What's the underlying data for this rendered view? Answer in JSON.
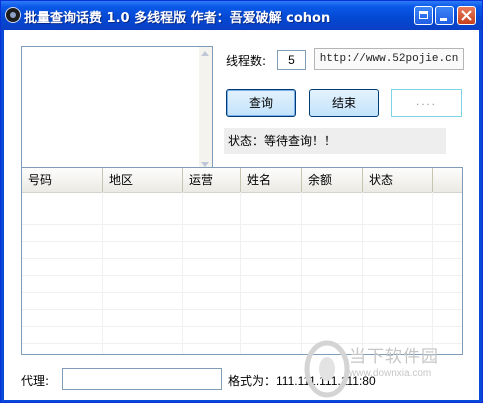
{
  "window": {
    "title": "批量查询话费 1.0 多线程版 作者：吾爱破解 cohon"
  },
  "controls": {
    "threads_label": "线程数:",
    "threads_value": "5",
    "url": "http://www.52pojie.cn",
    "query_button": "查询",
    "stop_button": "结束",
    "dots_box": "....",
    "status_text": "状态：等待查询！！"
  },
  "table": {
    "columns": [
      "号码",
      "地区",
      "运营",
      "姓名",
      "余额",
      "状态"
    ],
    "rows": []
  },
  "footer": {
    "proxy_label": "代理:",
    "proxy_value": "",
    "format_label": "格式为：111.111.111.111:80"
  },
  "watermark": {
    "text": "当下软件园",
    "url": "www.downxia.com"
  },
  "colors": {
    "titlebar": "#0a58e8",
    "button_face": "#c2e3fb",
    "close": "#c63f1c"
  }
}
